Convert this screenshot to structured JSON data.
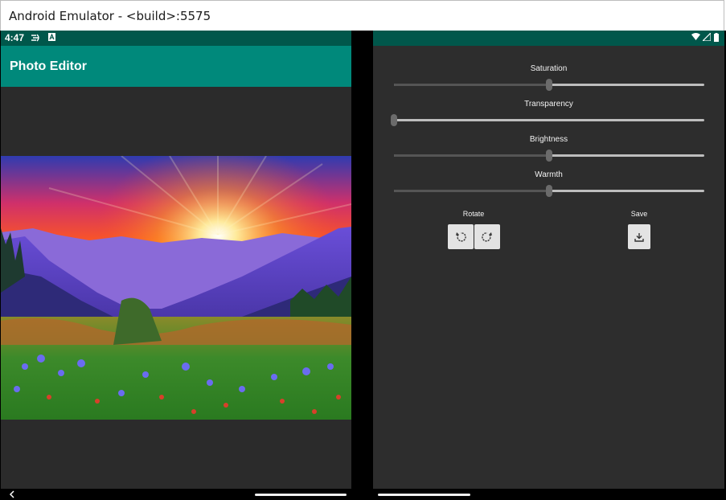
{
  "window": {
    "title": "Android Emulator - <build>:5575"
  },
  "status_bar": {
    "time": "4:47",
    "color": "#00574b"
  },
  "app_bar": {
    "title": "Photo Editor",
    "color": "#00897b"
  },
  "sliders": [
    {
      "label": "Saturation",
      "value": 0.5
    },
    {
      "label": "Transparency",
      "value": 0.0
    },
    {
      "label": "Brightness",
      "value": 0.5
    },
    {
      "label": "Warmth",
      "value": 0.5
    }
  ],
  "controls": {
    "rotate_label": "Rotate",
    "save_label": "Save",
    "icons": [
      "rotate-left-icon",
      "rotate-right-icon",
      "download-icon"
    ]
  }
}
